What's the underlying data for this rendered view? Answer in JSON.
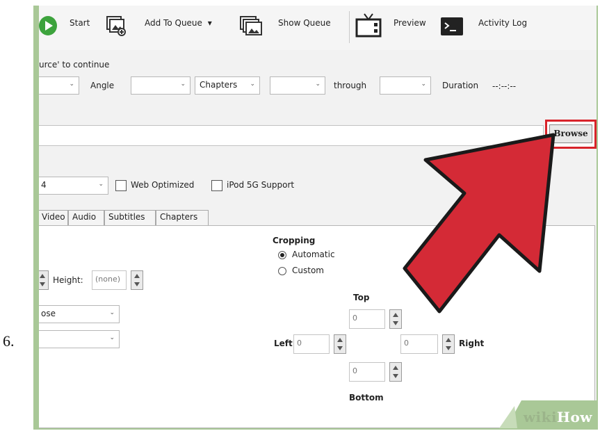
{
  "step_number": "6.",
  "toolbar": {
    "start_label": "Start",
    "add_queue_label": "Add To Queue",
    "add_queue_caret": "▾",
    "show_queue_label": "Show Queue",
    "preview_label": "Preview",
    "activity_log_label": "Activity Log"
  },
  "source": {
    "hint": "urce' to continue",
    "angle_label": "Angle",
    "chapters_value": "Chapters",
    "through_label": "through",
    "duration_label": "Duration",
    "duration_value": "--:--:--"
  },
  "destination": {
    "browse_label": "Browse"
  },
  "output": {
    "container_value": "4",
    "web_optimized_label": "Web Optimized",
    "ipod_label": "iPod 5G Support"
  },
  "tabs": [
    "Video",
    "Audio",
    "Subtitles",
    "Chapters"
  ],
  "picture": {
    "height_label": "Height:",
    "height_placeholder": "(none)",
    "anamorphic_value": "ose",
    "cropping_title": "Cropping",
    "automatic_label": "Automatic",
    "custom_label": "Custom",
    "top_label": "Top",
    "left_label": "Left",
    "right_label": "Right",
    "bottom_label": "Bottom",
    "top_value": "0",
    "left_value": "0",
    "right_value": "0",
    "bottom_value": "0"
  },
  "watermark": {
    "wiki": "wiki",
    "how": "How"
  },
  "colors": {
    "arrow_fill": "#d42a36",
    "highlight_border": "#d8232a",
    "frame_green": "#a9c897"
  }
}
